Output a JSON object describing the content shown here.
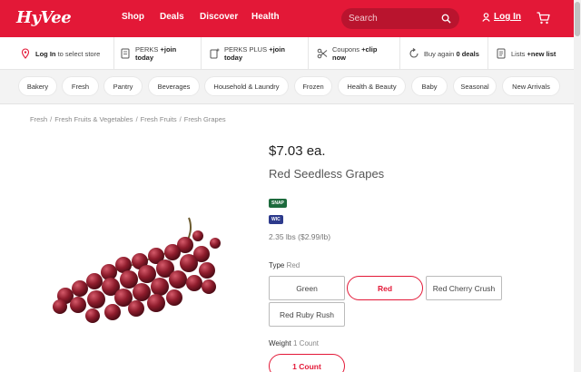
{
  "header": {
    "logo": "HyVee",
    "nav": [
      "Shop",
      "Deals",
      "Discover",
      "Health"
    ],
    "search_placeholder": "Search",
    "login_label": "Log In"
  },
  "utility_bar": {
    "store": {
      "bold": "Log In",
      "text": " to select store"
    },
    "perks": {
      "text": "PERKS ",
      "bold": "+join today"
    },
    "perks_plus": {
      "text": "PERKS PLUS ",
      "bold": "+join today"
    },
    "coupons": {
      "text": "Coupons ",
      "bold": "+clip now"
    },
    "buy_again": {
      "text": "Buy again ",
      "bold": "0 deals"
    },
    "lists": {
      "text": "Lists ",
      "bold": "+new list"
    }
  },
  "categories": [
    "Bakery",
    "Fresh",
    "Pantry",
    "Beverages",
    "Household & Laundry",
    "Frozen",
    "Health & Beauty",
    "Baby",
    "Seasonal",
    "New Arrivals"
  ],
  "breadcrumb": [
    "Fresh",
    "Fresh Fruits & Vegetables",
    "Fresh Fruits",
    "Fresh Grapes"
  ],
  "product": {
    "price": "$7.03 ea.",
    "name": "Red Seedless Grapes",
    "badges": [
      "SNAP",
      "WIC"
    ],
    "weight_price": "2.35 lbs ($2.99/lb)",
    "type_label": "Type",
    "type_value": "Red",
    "types": [
      "Green",
      "Red",
      "Red Cherry Crush",
      "Red Ruby Rush"
    ],
    "selected_type": "Red",
    "weight_label": "Weight",
    "weight_value": "1 Count",
    "weights": [
      "1 Count"
    ]
  },
  "colors": {
    "brand": "#e31837",
    "snap": "#1c6a3c",
    "wic": "#2d3a8c"
  }
}
